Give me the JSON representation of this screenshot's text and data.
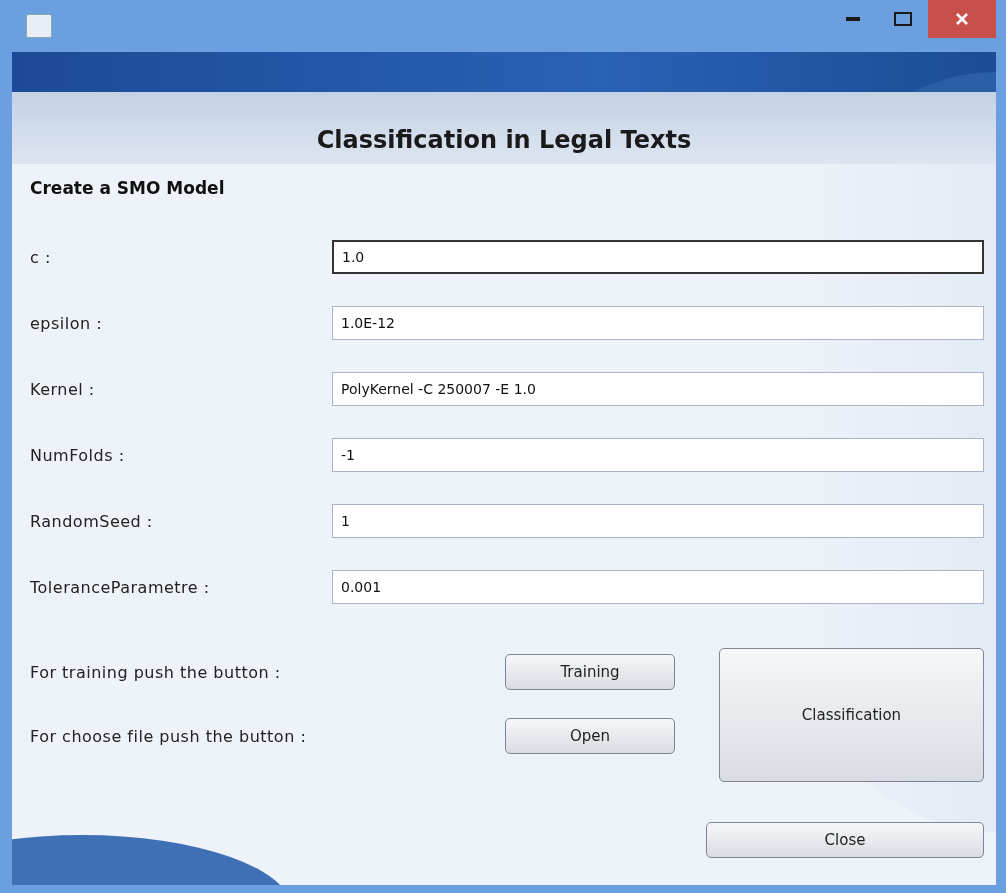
{
  "heading": "Classification in Legal Texts",
  "section_title": "Create a SMO Model",
  "fields": [
    {
      "label": "c :",
      "value": "1.0",
      "focused": true
    },
    {
      "label": "epsilon :",
      "value": "1.0E-12",
      "focused": false
    },
    {
      "label": "Kernel :",
      "value": "PolyKernel -C 250007 -E 1.0",
      "focused": false
    },
    {
      "label": "NumFolds :",
      "value": "-1",
      "focused": false
    },
    {
      "label": "RandomSeed :",
      "value": "1",
      "focused": false
    },
    {
      "label": "ToleranceParametre :",
      "value": "0.001",
      "focused": false
    }
  ],
  "actions": [
    {
      "label": "For training push the button :",
      "button": "Training"
    },
    {
      "label": "For choose file push the button :",
      "button": "Open"
    }
  ],
  "classify_button": "Classification",
  "close_button": "Close"
}
